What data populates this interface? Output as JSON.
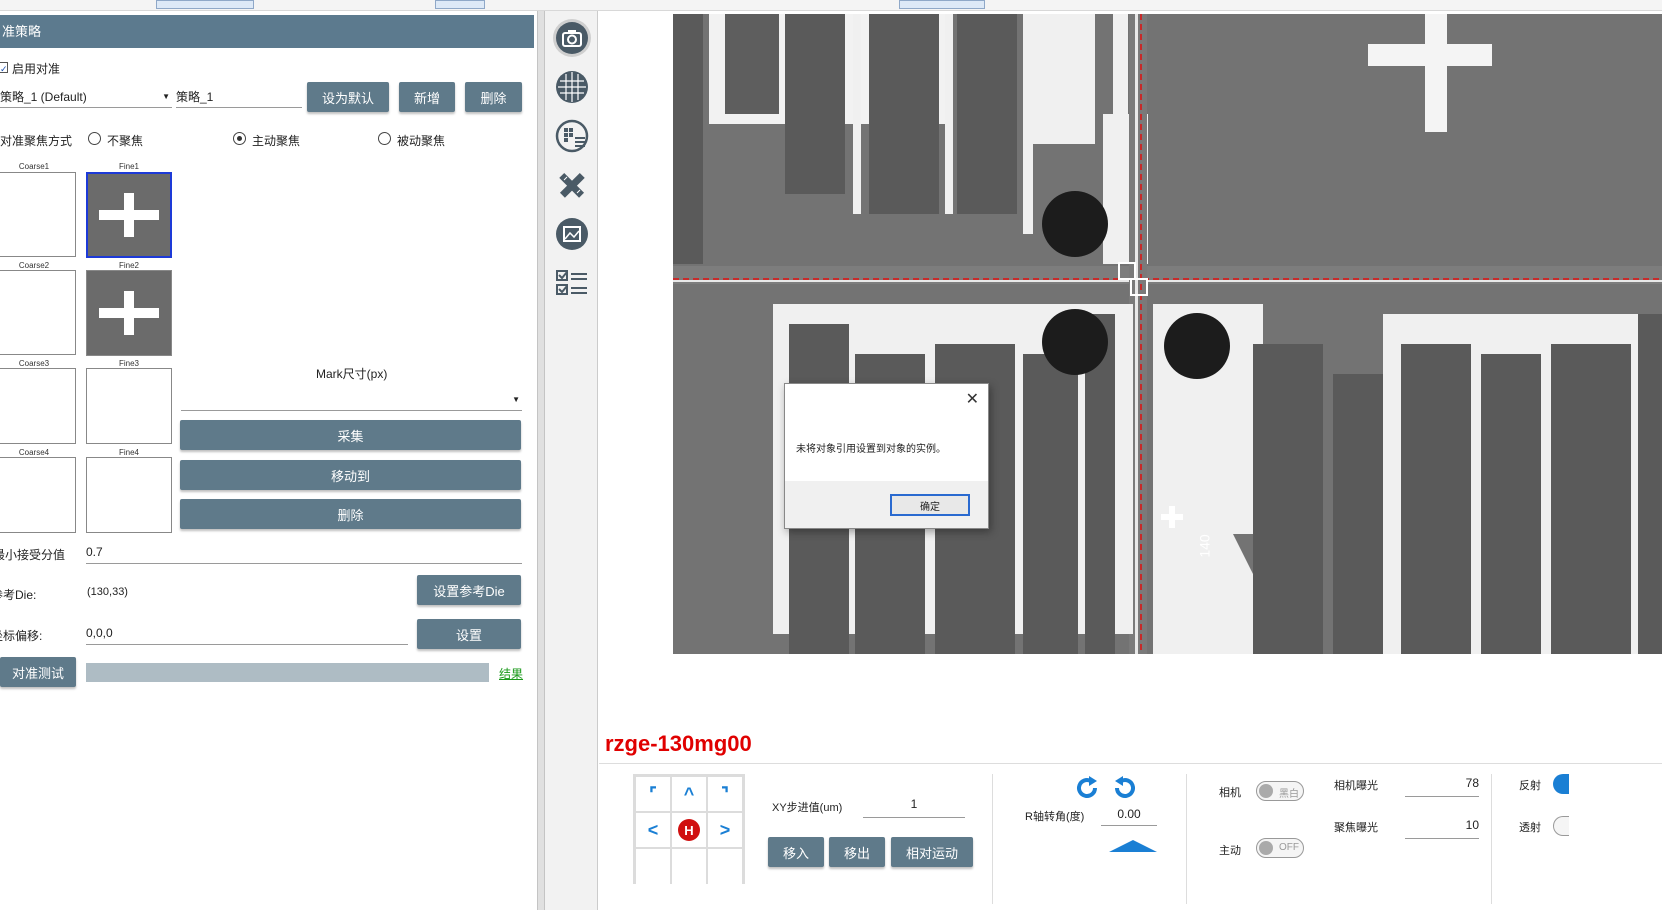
{
  "panel": {
    "title": "准策略",
    "enable_label": "启用对准",
    "strategy_select": "策略_1 (Default)",
    "strategy_name": "策略_1",
    "btn_set_default": "设为默认",
    "btn_add": "新增",
    "btn_delete": "删除",
    "focus_mode_label": "对准聚焦方式",
    "focus_options": [
      "不聚焦",
      "主动聚焦",
      "被动聚焦"
    ],
    "thumbs": {
      "coarse": [
        "Coarse1",
        "Coarse2",
        "Coarse3",
        "Coarse4"
      ],
      "fine": [
        "Fine1",
        "Fine2",
        "Fine3",
        "Fine4"
      ]
    },
    "mark_size_label": "Mark尺寸(px)",
    "btn_capture": "采集",
    "btn_move_to": "移动到",
    "btn_remove": "删除",
    "min_score_label": "最小接受分值",
    "min_score_value": "0.7",
    "ref_die_label": "参考Die:",
    "ref_die_value": "(130,33)",
    "btn_set_ref_die": "设置参考Die",
    "offset_label": "坐标偏移:",
    "offset_value": "0,0,0",
    "btn_set": "设置",
    "btn_test": "对准测试",
    "result_link": "结果"
  },
  "viewer": {
    "die_label": "rzge-130mg00",
    "wafer_mark_text": "140"
  },
  "dialog": {
    "message": "未将对象引用设置到对象的实例。",
    "ok_label": "确定",
    "close_glyph": "✕"
  },
  "controls": {
    "dpad_home": "H",
    "xy_step_label": "XY步进值(um)",
    "xy_step_value": "1",
    "btn_move_in": "移入",
    "btn_move_out": "移出",
    "btn_relative": "相对运动",
    "r_angle_label": "R轴转角(度)",
    "r_angle_value": "0.00",
    "camera_label": "相机",
    "camera_toggle": "黑白",
    "active_label": "主动",
    "active_toggle": "OFF",
    "camera_exposure_label": "相机曝光",
    "camera_exposure_value": "78",
    "focus_exposure_label": "聚焦曝光",
    "focus_exposure_value": "10",
    "reflect_label": "反射",
    "transmit_label": "透射"
  },
  "colors": {
    "button": "#5f7a8a",
    "header": "#5c7a8e",
    "accent_red": "#e00000",
    "icon_blue": "#1a7fd4"
  }
}
